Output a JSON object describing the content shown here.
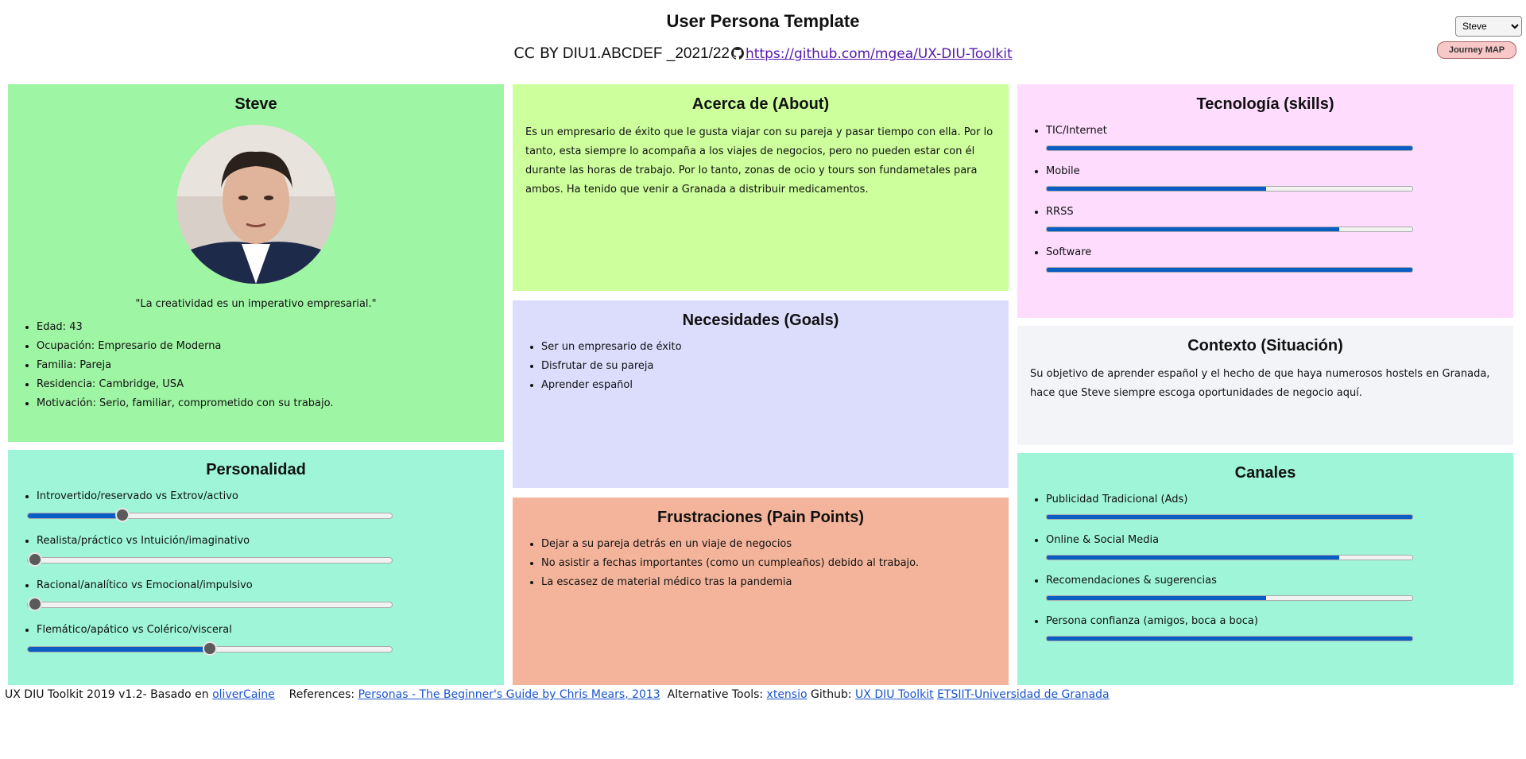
{
  "header": {
    "title": "User Persona Template",
    "license": "CC BY",
    "course": "DIU1.ABCDEF _2021/22",
    "repo_link": "https://github.com/mgea/UX-DIU-Toolkit",
    "persona_select_value": "Steve",
    "journey_button": "Journey MAP"
  },
  "profile": {
    "name": "Steve",
    "quote": "\"La creatividad es un imperativo empresarial.\"",
    "facts": [
      "Edad: 43",
      "Ocupación: Empresario de Moderna",
      "Familia: Pareja",
      "Residencia: Cambridge, USA",
      "Motivación: Serio, familiar, comprometido con su trabajo."
    ]
  },
  "about": {
    "title": "Acerca de (About)",
    "text": "Es un empresario de éxito que le gusta viajar con su pareja y pasar tiempo con ella. Por lo tanto, esta siempre lo acompaña a los viajes de negocios, pero no pueden estar con él durante las horas de trabajo. Por lo tanto, zonas de ocio y tours son fundametales para ambos. Ha tenido que venir a Granada a distribuir medicamentos."
  },
  "goals": {
    "title": "Necesidades (Goals)",
    "items": [
      "Ser un empresario de éxito",
      "Disfrutar de su pareja",
      "Aprender español"
    ]
  },
  "pain_points": {
    "title": "Frustraciones (Pain Points)",
    "items": [
      "Dejar a su pareja detrás en un viaje de negocios",
      "No asistir a fechas importantes (como un cumpleaños) debido al trabajo.",
      "La escasez de material médico tras la pandemia"
    ]
  },
  "skills": {
    "title": "Tecnología (skills)",
    "items": [
      {
        "label": "TIC/Internet",
        "level": 1.0
      },
      {
        "label": "Mobile",
        "level": 0.6
      },
      {
        "label": "RRSS",
        "level": 0.8
      },
      {
        "label": "Software",
        "level": 1.0
      }
    ]
  },
  "context": {
    "title": "Contexto (Situación)",
    "text": "Su objetivo de aprender español y el hecho de que haya numerosos hostels en Granada, hace que Steve siempre escoga oportunidades de negocio aquí."
  },
  "personality": {
    "title": "Personalidad",
    "items": [
      {
        "label": "Introvertido/reservado vs Extrov/activo",
        "level": 0.26
      },
      {
        "label": "Realista/práctico vs Intuición/imaginativo",
        "level": 0.02
      },
      {
        "label": "Racional/analítico vs Emocional/impulsivo",
        "level": 0.02
      },
      {
        "label": "Flemático/apático vs Colérico/visceral",
        "level": 0.5
      }
    ]
  },
  "channels": {
    "title": "Canales",
    "items": [
      {
        "label": "Publicidad Tradicional (Ads)",
        "level": 1.0
      },
      {
        "label": "Online & Social Media",
        "level": 0.8
      },
      {
        "label": "Recomendaciones & sugerencias",
        "level": 0.6
      },
      {
        "label": "Persona confianza (amigos, boca a boca)",
        "level": 1.0
      }
    ]
  },
  "footer": {
    "prefix": "UX DIU Toolkit 2019 v1.2- Basado en",
    "link_olivercaine": "oliverCaine",
    "references_label": "References:",
    "link_personas": "Personas - The Beginner's Guide by Chris Mears, 2013",
    "alt_tools_label": "Alternative Tools:",
    "link_xtensio": "xtensio",
    "github_label": "Github:",
    "link_toolkit": "UX DIU Toolkit",
    "link_etsiit": "ETSIIT-Universidad de Granada"
  },
  "colors": {
    "profile_bg": "#9ef5a3",
    "about_bg": "#cdff9c",
    "goals_bg": "#dcdcfd",
    "pain_bg": "#f3b49b",
    "skills_bg": "#fedcfe",
    "context_bg": "#f3f4f8",
    "personality_bg": "#9ef5d8",
    "channels_bg": "#9ef5d8",
    "bar_fill": "#0a5dc2"
  }
}
